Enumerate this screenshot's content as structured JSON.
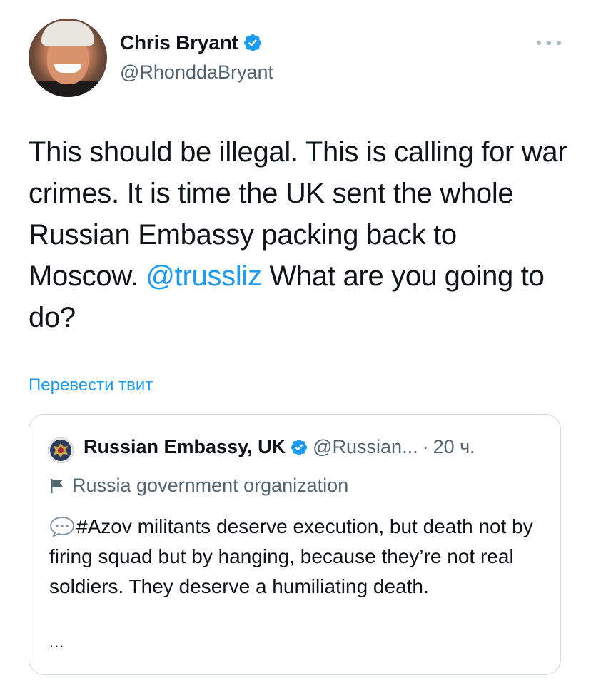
{
  "author": {
    "display_name": "Chris Bryant",
    "handle": "@RhonddaBryant"
  },
  "tweet": {
    "text_before_mention": "This should be illegal. This is calling for war crimes. It is time the UK sent the whole Russian Embassy packing back to Moscow. ",
    "mention": "@trussliz",
    "text_after_mention": " What are you going to do?"
  },
  "translate_link": "Перевести твит",
  "quoted_tweet": {
    "display_name": "Russian Embassy, UK",
    "handle": "@Russian...",
    "separator": "·",
    "time": "20 ч.",
    "label": "Russia government organization",
    "text": "#Azov militants deserve execution, but death not by firing squad but by hanging, because they’re not real soldiers. They deserve a humiliating death.",
    "ellipsis": "..."
  },
  "icons": {
    "verified": "verified-badge-icon",
    "more": "more-options-icon",
    "flag": "flag-icon",
    "speech": "speech-bubble-icon"
  },
  "colors": {
    "accent": "#1d9bf0",
    "text": "#0f1419",
    "secondary": "#536471",
    "border": "#cfd9de"
  }
}
